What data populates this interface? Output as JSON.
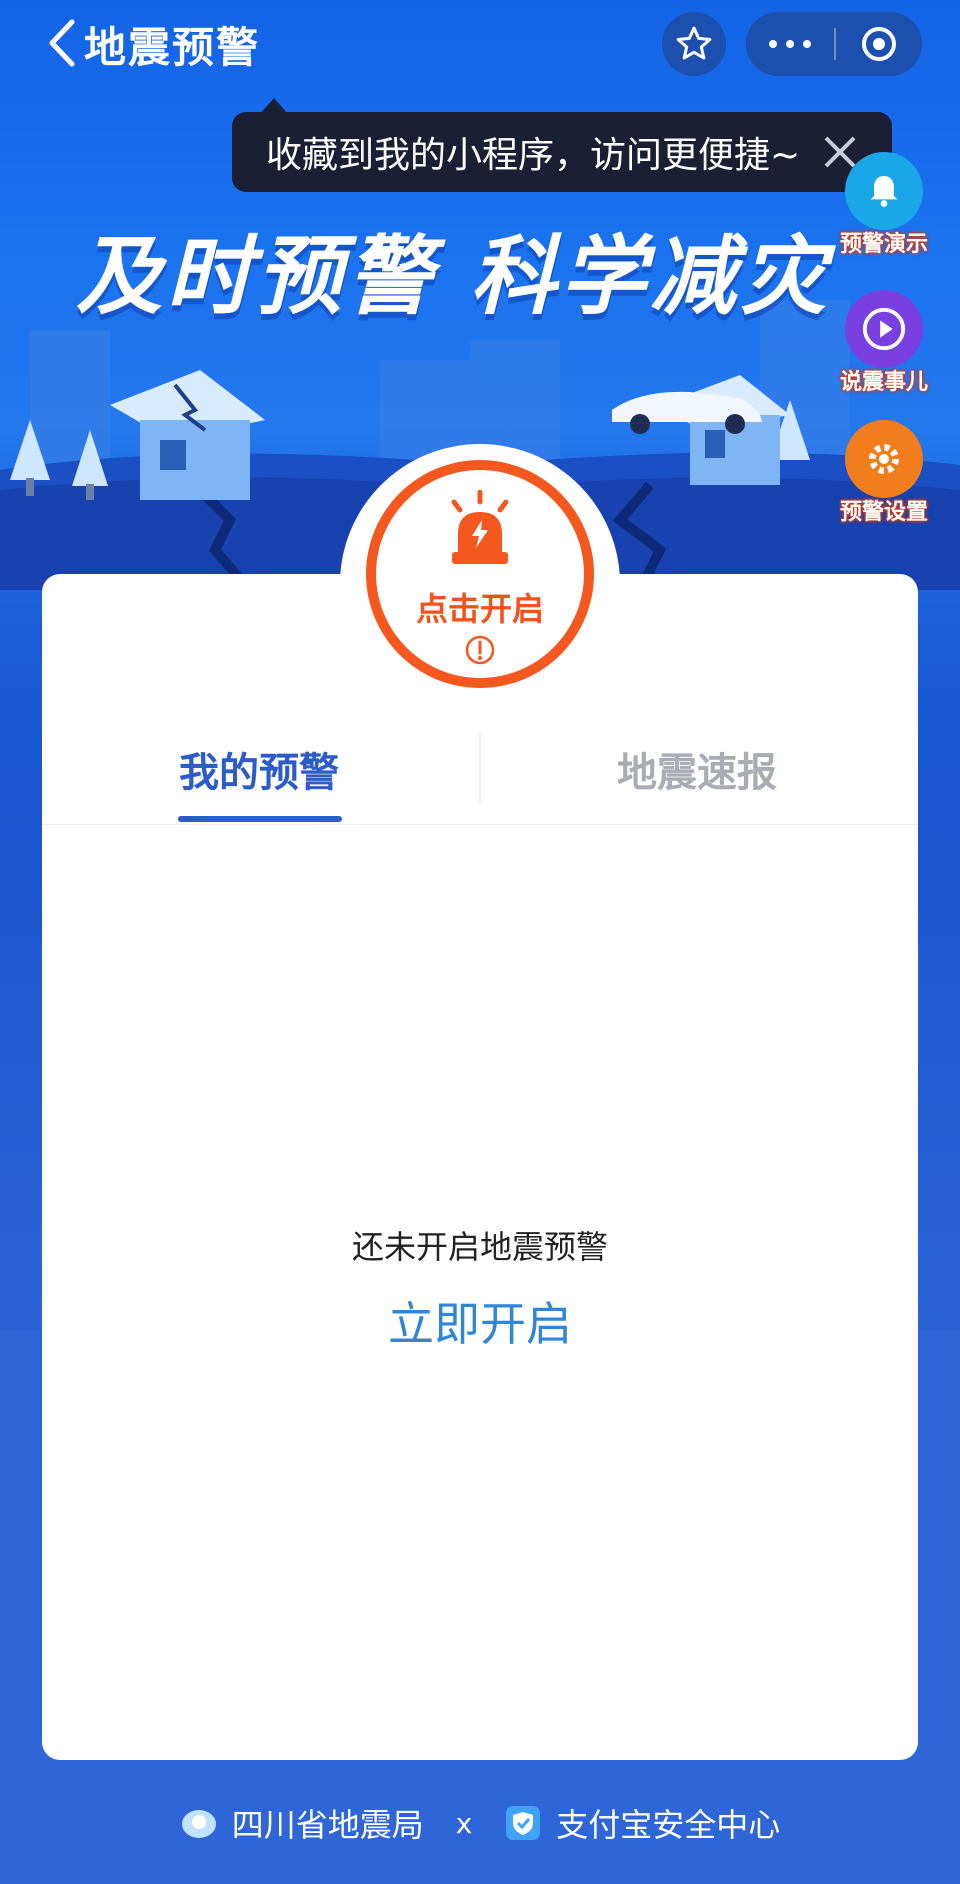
{
  "topbar": {
    "title": "地震预警",
    "back_icon": "chevron-left-icon",
    "favorite_icon": "star-icon",
    "more_icon": "more-dots-icon",
    "close_icon": "target-icon"
  },
  "tooltip": {
    "text": "收藏到我的小程序，访问更便捷~",
    "close_icon": "close-icon"
  },
  "banner": {
    "slogan": "及时预警 科学减灾"
  },
  "side_buttons": [
    {
      "label": "预警演示",
      "icon": "bell-icon",
      "color": "#1aa7e8"
    },
    {
      "label": "说震事儿",
      "icon": "play-icon",
      "color": "#7a3fe0"
    },
    {
      "label": "预警设置",
      "icon": "gear-icon",
      "color": "#f27d1c"
    }
  ],
  "alarm_button": {
    "label": "点击开启",
    "icon": "siren-icon",
    "info_icon": "exclamation-icon",
    "color": "#f4581f"
  },
  "tabs": [
    {
      "label": "我的预警",
      "active": true
    },
    {
      "label": "地震速报",
      "active": false
    }
  ],
  "empty_state": {
    "message": "还未开启地震预警",
    "action": "立即开启"
  },
  "footer": {
    "org1": "四川省地震局",
    "separator": "x",
    "org2": "支付宝安全中心"
  }
}
